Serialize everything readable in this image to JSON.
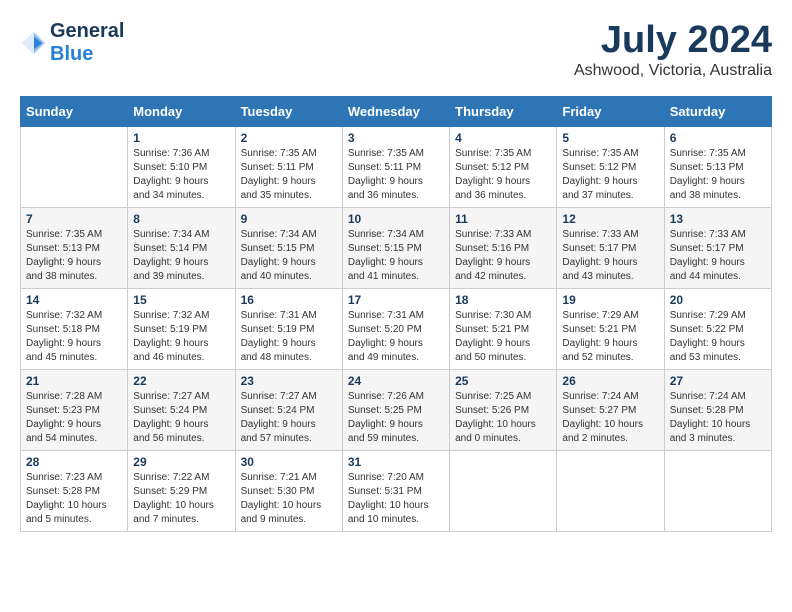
{
  "header": {
    "logo_line1": "General",
    "logo_line2": "Blue",
    "month": "July 2024",
    "location": "Ashwood, Victoria, Australia"
  },
  "weekdays": [
    "Sunday",
    "Monday",
    "Tuesday",
    "Wednesday",
    "Thursday",
    "Friday",
    "Saturday"
  ],
  "weeks": [
    [
      {
        "day": "",
        "info": ""
      },
      {
        "day": "1",
        "info": "Sunrise: 7:36 AM\nSunset: 5:10 PM\nDaylight: 9 hours\nand 34 minutes."
      },
      {
        "day": "2",
        "info": "Sunrise: 7:35 AM\nSunset: 5:11 PM\nDaylight: 9 hours\nand 35 minutes."
      },
      {
        "day": "3",
        "info": "Sunrise: 7:35 AM\nSunset: 5:11 PM\nDaylight: 9 hours\nand 36 minutes."
      },
      {
        "day": "4",
        "info": "Sunrise: 7:35 AM\nSunset: 5:12 PM\nDaylight: 9 hours\nand 36 minutes."
      },
      {
        "day": "5",
        "info": "Sunrise: 7:35 AM\nSunset: 5:12 PM\nDaylight: 9 hours\nand 37 minutes."
      },
      {
        "day": "6",
        "info": "Sunrise: 7:35 AM\nSunset: 5:13 PM\nDaylight: 9 hours\nand 38 minutes."
      }
    ],
    [
      {
        "day": "7",
        "info": "Sunrise: 7:35 AM\nSunset: 5:13 PM\nDaylight: 9 hours\nand 38 minutes."
      },
      {
        "day": "8",
        "info": "Sunrise: 7:34 AM\nSunset: 5:14 PM\nDaylight: 9 hours\nand 39 minutes."
      },
      {
        "day": "9",
        "info": "Sunrise: 7:34 AM\nSunset: 5:15 PM\nDaylight: 9 hours\nand 40 minutes."
      },
      {
        "day": "10",
        "info": "Sunrise: 7:34 AM\nSunset: 5:15 PM\nDaylight: 9 hours\nand 41 minutes."
      },
      {
        "day": "11",
        "info": "Sunrise: 7:33 AM\nSunset: 5:16 PM\nDaylight: 9 hours\nand 42 minutes."
      },
      {
        "day": "12",
        "info": "Sunrise: 7:33 AM\nSunset: 5:17 PM\nDaylight: 9 hours\nand 43 minutes."
      },
      {
        "day": "13",
        "info": "Sunrise: 7:33 AM\nSunset: 5:17 PM\nDaylight: 9 hours\nand 44 minutes."
      }
    ],
    [
      {
        "day": "14",
        "info": "Sunrise: 7:32 AM\nSunset: 5:18 PM\nDaylight: 9 hours\nand 45 minutes."
      },
      {
        "day": "15",
        "info": "Sunrise: 7:32 AM\nSunset: 5:19 PM\nDaylight: 9 hours\nand 46 minutes."
      },
      {
        "day": "16",
        "info": "Sunrise: 7:31 AM\nSunset: 5:19 PM\nDaylight: 9 hours\nand 48 minutes."
      },
      {
        "day": "17",
        "info": "Sunrise: 7:31 AM\nSunset: 5:20 PM\nDaylight: 9 hours\nand 49 minutes."
      },
      {
        "day": "18",
        "info": "Sunrise: 7:30 AM\nSunset: 5:21 PM\nDaylight: 9 hours\nand 50 minutes."
      },
      {
        "day": "19",
        "info": "Sunrise: 7:29 AM\nSunset: 5:21 PM\nDaylight: 9 hours\nand 52 minutes."
      },
      {
        "day": "20",
        "info": "Sunrise: 7:29 AM\nSunset: 5:22 PM\nDaylight: 9 hours\nand 53 minutes."
      }
    ],
    [
      {
        "day": "21",
        "info": "Sunrise: 7:28 AM\nSunset: 5:23 PM\nDaylight: 9 hours\nand 54 minutes."
      },
      {
        "day": "22",
        "info": "Sunrise: 7:27 AM\nSunset: 5:24 PM\nDaylight: 9 hours\nand 56 minutes."
      },
      {
        "day": "23",
        "info": "Sunrise: 7:27 AM\nSunset: 5:24 PM\nDaylight: 9 hours\nand 57 minutes."
      },
      {
        "day": "24",
        "info": "Sunrise: 7:26 AM\nSunset: 5:25 PM\nDaylight: 9 hours\nand 59 minutes."
      },
      {
        "day": "25",
        "info": "Sunrise: 7:25 AM\nSunset: 5:26 PM\nDaylight: 10 hours\nand 0 minutes."
      },
      {
        "day": "26",
        "info": "Sunrise: 7:24 AM\nSunset: 5:27 PM\nDaylight: 10 hours\nand 2 minutes."
      },
      {
        "day": "27",
        "info": "Sunrise: 7:24 AM\nSunset: 5:28 PM\nDaylight: 10 hours\nand 3 minutes."
      }
    ],
    [
      {
        "day": "28",
        "info": "Sunrise: 7:23 AM\nSunset: 5:28 PM\nDaylight: 10 hours\nand 5 minutes."
      },
      {
        "day": "29",
        "info": "Sunrise: 7:22 AM\nSunset: 5:29 PM\nDaylight: 10 hours\nand 7 minutes."
      },
      {
        "day": "30",
        "info": "Sunrise: 7:21 AM\nSunset: 5:30 PM\nDaylight: 10 hours\nand 9 minutes."
      },
      {
        "day": "31",
        "info": "Sunrise: 7:20 AM\nSunset: 5:31 PM\nDaylight: 10 hours\nand 10 minutes."
      },
      {
        "day": "",
        "info": ""
      },
      {
        "day": "",
        "info": ""
      },
      {
        "day": "",
        "info": ""
      }
    ]
  ]
}
